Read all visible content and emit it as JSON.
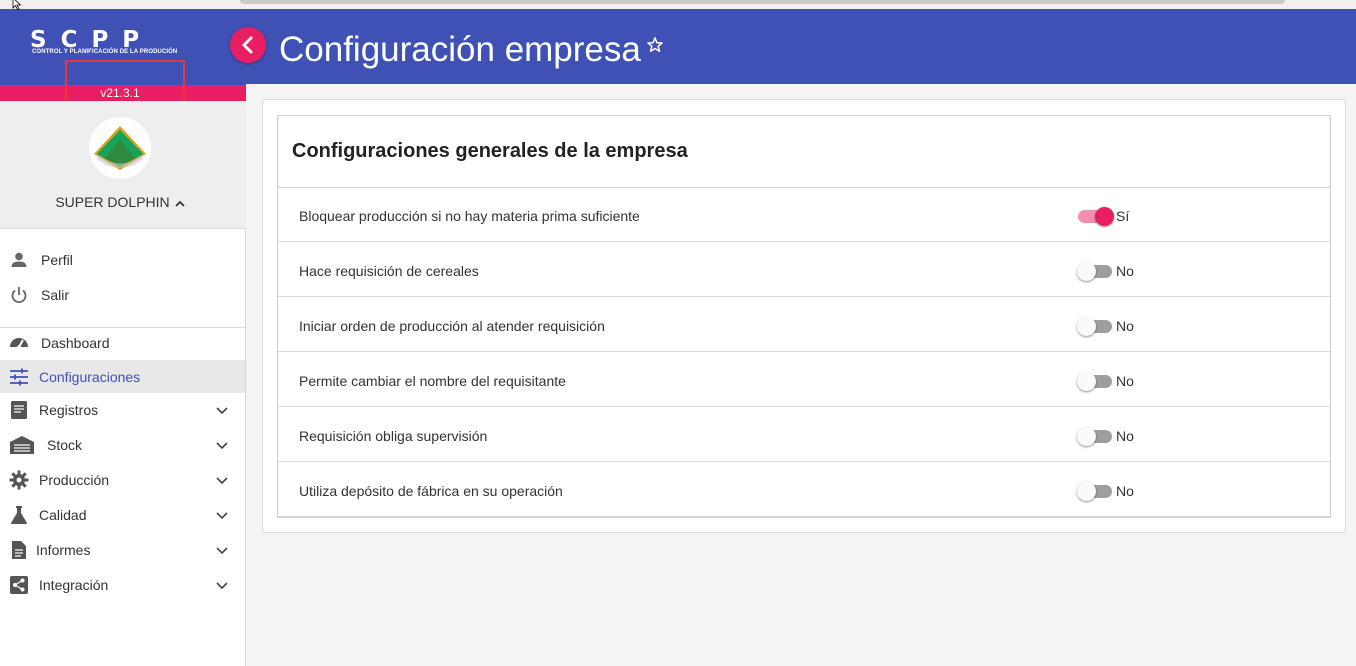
{
  "app": {
    "logo_text": "SCPP",
    "logo_subtitle": "CONTROL Y PLANIFICACIÓN DE LA PRODUCIÓN",
    "version": "v21.3.1"
  },
  "colors": {
    "primary": "#3f51b5",
    "accent": "#e91e63"
  },
  "user": {
    "company_name": "SUPER DOLPHIN"
  },
  "menu": {
    "account": [
      {
        "label": "Perfil",
        "icon": "person-icon"
      },
      {
        "label": "Salir",
        "icon": "power-icon"
      }
    ],
    "items": [
      {
        "label": "Dashboard",
        "icon": "speedometer-icon",
        "expandable": false
      },
      {
        "label": "Configuraciones",
        "icon": "sliders-icon",
        "expandable": false,
        "active": true
      },
      {
        "label": "Registros",
        "icon": "book-icon",
        "expandable": true
      },
      {
        "label": "Stock",
        "icon": "warehouse-icon",
        "expandable": true
      },
      {
        "label": "Producción",
        "icon": "gear-icon",
        "expandable": true
      },
      {
        "label": "Calidad",
        "icon": "flask-icon",
        "expandable": true
      },
      {
        "label": "Informes",
        "icon": "document-icon",
        "expandable": true
      },
      {
        "label": "Integración",
        "icon": "share-icon",
        "expandable": true
      }
    ]
  },
  "header": {
    "title": "Configuración empresa",
    "favorite_icon": "star-outline-icon"
  },
  "card": {
    "title": "Configuraciones generales de la empresa",
    "settings": [
      {
        "label": "Bloquear producción si no hay materia prima suficiente",
        "on": true,
        "state": "Sí"
      },
      {
        "label": "Hace requisición de cereales",
        "on": false,
        "state": "No"
      },
      {
        "label": "Iniciar orden de producción al atender requisición",
        "on": false,
        "state": "No"
      },
      {
        "label": "Permite cambiar el nombre del requisitante",
        "on": false,
        "state": "No"
      },
      {
        "label": "Requisición obliga supervisión",
        "on": false,
        "state": "No"
      },
      {
        "label": "Utiliza depósito de fábrica en su operación",
        "on": false,
        "state": "No"
      }
    ]
  }
}
